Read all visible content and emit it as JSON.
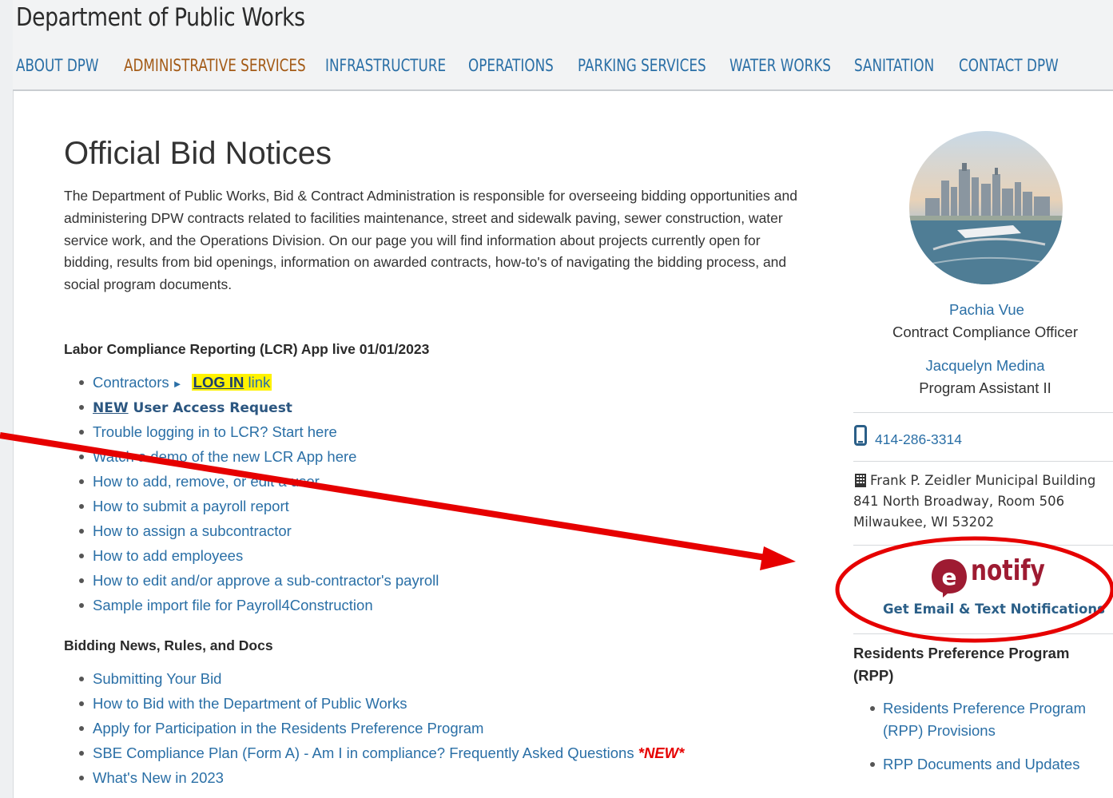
{
  "header": {
    "site_title": "Department of Public Works",
    "nav": [
      {
        "label": "ABOUT DPW"
      },
      {
        "label": "ADMINISTRATIVE SERVICES"
      },
      {
        "label": "INFRASTRUCTURE"
      },
      {
        "label": "OPERATIONS"
      },
      {
        "label": "PARKING SERVICES"
      },
      {
        "label": "WATER WORKS"
      },
      {
        "label": "SANITATION"
      },
      {
        "label": "CONTACT DPW"
      }
    ]
  },
  "main": {
    "title": "Official Bid Notices",
    "intro": "The Department of Public Works, Bid & Contract Administration is responsible for overseeing bidding opportunities and administering DPW contracts related to facilities maintenance, street and sidewalk paving, sewer construction, water service work, and the Operations Division. On our page you will find information about projects currently open for bidding, results from bid openings, information on awarded contracts, how-to's of navigating the bidding process, and social program documents.",
    "lcr": {
      "heading": "Labor Compliance Reporting (LCR) App live 01/01/2023",
      "contractors_label": "Contractors",
      "arrow": "►",
      "login_label": "LOG IN",
      "login_suffix": "link",
      "new_label": "NEW",
      "user_access_label": "User Access Request",
      "links": [
        "Trouble logging in to LCR? Start here",
        "Watch a demo of the new LCR App here",
        "How to add, remove, or edit a user",
        "How to submit a payroll report",
        "How to assign a subcontractor",
        "How to add employees",
        "How to edit and/or approve a sub-contractor's payroll",
        "Sample import file for Payroll4Construction"
      ]
    },
    "bidding": {
      "heading": "Bidding News, Rules, and Docs",
      "links": [
        "Submitting Your Bid",
        "How to Bid with the Department of Public Works",
        "Apply for Participation in the Residents Preference Program",
        "SBE Compliance Plan (Form A) - Am I in compliance? Frequently Asked Questions",
        "What's New in 2023"
      ],
      "new_badge": "*NEW*"
    }
  },
  "sidebar": {
    "contacts": [
      {
        "name": "Pachia Vue",
        "role": "Contract Compliance Officer"
      },
      {
        "name": "Jacquelyn Medina",
        "role": "Program Assistant II"
      }
    ],
    "phone": "414-286-3314",
    "address": {
      "building": "Frank P. Zeidler Municipal Building",
      "street": "841 North Broadway, Room 506",
      "city": "Milwaukee, WI 53202"
    },
    "enotify": {
      "logo_letter": "e",
      "logo_text": "notify",
      "subtitle": "Get Email & Text Notifications"
    },
    "rpp": {
      "heading": "Residents Preference Program (RPP)",
      "links": [
        "Residents Preference Program (RPP) Provisions",
        "RPP Documents and Updates"
      ]
    }
  },
  "colors": {
    "link": "#2a6fa6",
    "nav_active": "#a35a16",
    "highlight": "#fff200",
    "annotation": "#e60000",
    "enotify_brand": "#9e1b32"
  },
  "icons": {
    "phone": "mobile-phone-icon",
    "building": "building-icon"
  }
}
